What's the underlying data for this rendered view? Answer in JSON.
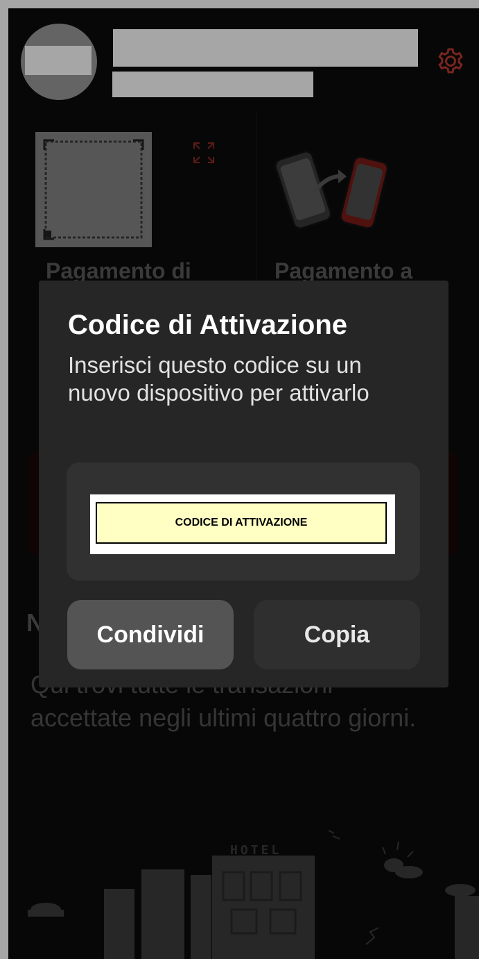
{
  "header": {
    "settings_icon": "gear-icon",
    "accent_color": "#c0392b"
  },
  "tiles": [
    {
      "label": "Pagamento di",
      "icon": "qr-code-icon"
    },
    {
      "label": "Pagamento a",
      "icon": "phone-transfer-icon"
    }
  ],
  "background": {
    "section_initial": "N",
    "info_text": "Qui trovi tutte le transazioni accettate negli ultimi quattro giorni."
  },
  "dialog": {
    "title": "Codice di Attivazione",
    "message": "Inserisci questo codice su un nuovo dispositivo per attivarlo",
    "code_label": "CODICE DI ATTIVAZIONE",
    "share_label": "Condividi",
    "copy_label": "Copia"
  },
  "illustration": {
    "hotel_sign": "HOTEL"
  }
}
